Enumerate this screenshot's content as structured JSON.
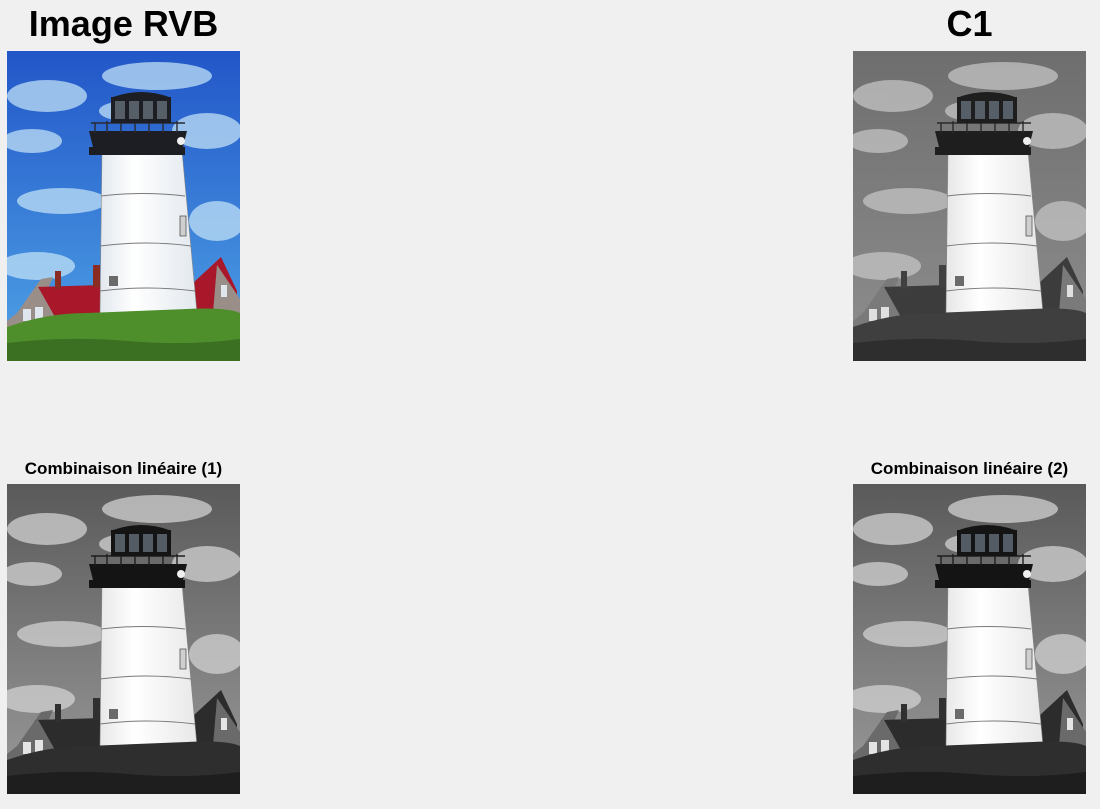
{
  "figure": {
    "background": "#f0f0f0",
    "panels": [
      {
        "id": "p1",
        "title": "Image RVB",
        "mode": "color",
        "icon": "lighthouse-photo"
      },
      {
        "id": "p2",
        "title": "C1",
        "mode": "gray-flat",
        "icon": "lighthouse-photo"
      },
      {
        "id": "p3",
        "title": "Combinaison linéaire (1)",
        "mode": "gray-contrast",
        "icon": "lighthouse-photo"
      },
      {
        "id": "p4",
        "title": "Combinaison linéaire (2)",
        "mode": "gray-contrast",
        "icon": "lighthouse-photo"
      }
    ]
  },
  "colors": {
    "color": {
      "skyTop": "#2256c8",
      "skyBottom": "#4fa3e6",
      "cloud": "#bfe0f6",
      "grass": "#4e8f2c",
      "grassDark": "#3b6f22",
      "roof": "#a8182a",
      "wall": "#9a8f88",
      "tower": "#ffffff",
      "towerShade": "#e2e8ee",
      "lantern": "#1d1d24",
      "rail": "#2a2a30",
      "chimney": "#8a2c22",
      "window": "#dfe6ee"
    },
    "gray-flat": {
      "skyTop": "#6e6e6e",
      "skyBottom": "#8e8e8e",
      "cloud": "#c4c4c4",
      "grass": "#3f3f3f",
      "grassDark": "#2e2e2e",
      "roof": "#3c3c3c",
      "wall": "#7a7a7a",
      "tower": "#ffffff",
      "towerShade": "#e6e6e6",
      "lantern": "#1e1e1e",
      "rail": "#2a2a2a",
      "chimney": "#404040",
      "window": "#e0e0e0"
    },
    "gray-contrast": {
      "skyTop": "#5a5a5a",
      "skyBottom": "#9a9a9a",
      "cloud": "#d2d2d2",
      "grass": "#2e2e2e",
      "grassDark": "#1e1e1e",
      "roof": "#2c2c2c",
      "wall": "#6a6a6a",
      "tower": "#ffffff",
      "towerShade": "#e8e8e8",
      "lantern": "#141414",
      "rail": "#1e1e1e",
      "chimney": "#303030",
      "window": "#e4e4e4"
    }
  }
}
